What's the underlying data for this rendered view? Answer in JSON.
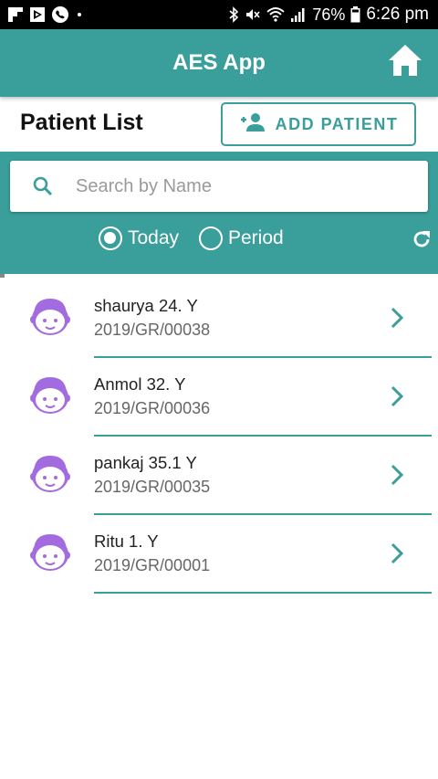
{
  "status_bar": {
    "battery": "76%",
    "time": "6:26 pm"
  },
  "app_bar": {
    "title": "AES App"
  },
  "header": {
    "title": "Patient List",
    "add_button_label": "ADD PATIENT"
  },
  "search": {
    "placeholder": "Search by Name",
    "value": ""
  },
  "filter": {
    "options": [
      {
        "label": "Today",
        "selected": true
      },
      {
        "label": "Period",
        "selected": false
      }
    ]
  },
  "patients": [
    {
      "name": "shaurya 24. Y",
      "id": "2019/GR/00038"
    },
    {
      "name": "Anmol 32. Y",
      "id": "2019/GR/00036"
    },
    {
      "name": "pankaj 35.1 Y",
      "id": "2019/GR/00035"
    },
    {
      "name": "Ritu 1. Y",
      "id": "2019/GR/00001"
    }
  ],
  "colors": {
    "primary": "#3a9e9a",
    "avatar": "#a36be0"
  },
  "icons": {
    "home": "home-icon",
    "add_person": "add-person-icon",
    "search": "search-icon",
    "refresh": "refresh-icon",
    "avatar": "child-face-icon",
    "chevron": "chevron-right-icon"
  }
}
